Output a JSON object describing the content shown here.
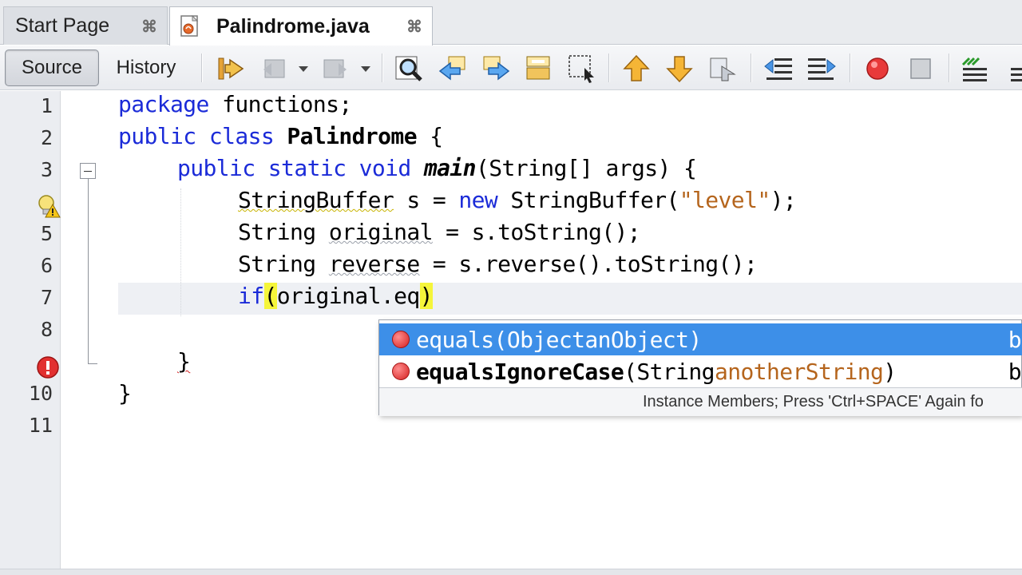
{
  "tabs": [
    {
      "label": "Start Page",
      "active": false,
      "close": "⌘"
    },
    {
      "label": "Palindrome.java",
      "active": true,
      "close": "⌘"
    }
  ],
  "toolbar": {
    "source_label": "Source",
    "history_label": "History",
    "icons": [
      "last-edit-icon",
      "back-icon",
      "forward-icon",
      "find-icon",
      "find-previous-icon",
      "find-next-icon",
      "toggle-highlight-icon",
      "find-selection-icon",
      "previous-bookmark-icon",
      "next-bookmark-icon",
      "toggle-bookmark-icon",
      "shift-left-icon",
      "shift-right-icon",
      "start-macro-icon",
      "stop-macro-icon",
      "comment-icon"
    ]
  },
  "editor": {
    "line_numbers": [
      "1",
      "2",
      "3",
      "4",
      "5",
      "6",
      "7",
      "8",
      "9",
      "10",
      "11"
    ],
    "lines": {
      "l1_kw": "package",
      "l1_rest": " functions;",
      "l2_kw1": "public",
      "l2_kw2": "class",
      "l2_name": "Palindrome",
      "l2_rest": " {",
      "l3_kw": "public static void",
      "l3_method": "main",
      "l3_rest": "(String[] args) {",
      "l4_type": "StringBuffer",
      "l4_mid": " s = ",
      "l4_new": "new",
      "l4_ctor": " StringBuffer(",
      "l4_str": "\"level\"",
      "l4_end": ");",
      "l5_type": "String ",
      "l5_var": "original",
      "l5_rest": " = s.toString();",
      "l6_type": "String ",
      "l6_var": "reverse",
      "l6_rest": " = s.reverse().toString();",
      "l7_kw": "if",
      "l7_open": "(",
      "l7_rest": "original.eq",
      "l7_close": ")",
      "l9_brace": "}",
      "l10_brace": "}"
    },
    "gutter_markers": [
      "hint-warning-icon",
      "error-icon"
    ]
  },
  "completion": {
    "items": [
      {
        "name": "equals",
        "sig_open": "(",
        "param_type": "Object ",
        "param_name": "anObject",
        "sig_close": ")",
        "trail": "b"
      },
      {
        "name": "equalsIgnoreCase",
        "sig_open": "(",
        "param_type": "String ",
        "param_name": "anotherString",
        "sig_close": ")",
        "trail": "b"
      }
    ],
    "status": "Instance Members; Press 'Ctrl+SPACE' Again fo"
  },
  "colors": {
    "keyword": "#1b2bd8",
    "string": "#b5651d",
    "selection": "#3d8fe8",
    "brace_match": "#f5f53a"
  }
}
